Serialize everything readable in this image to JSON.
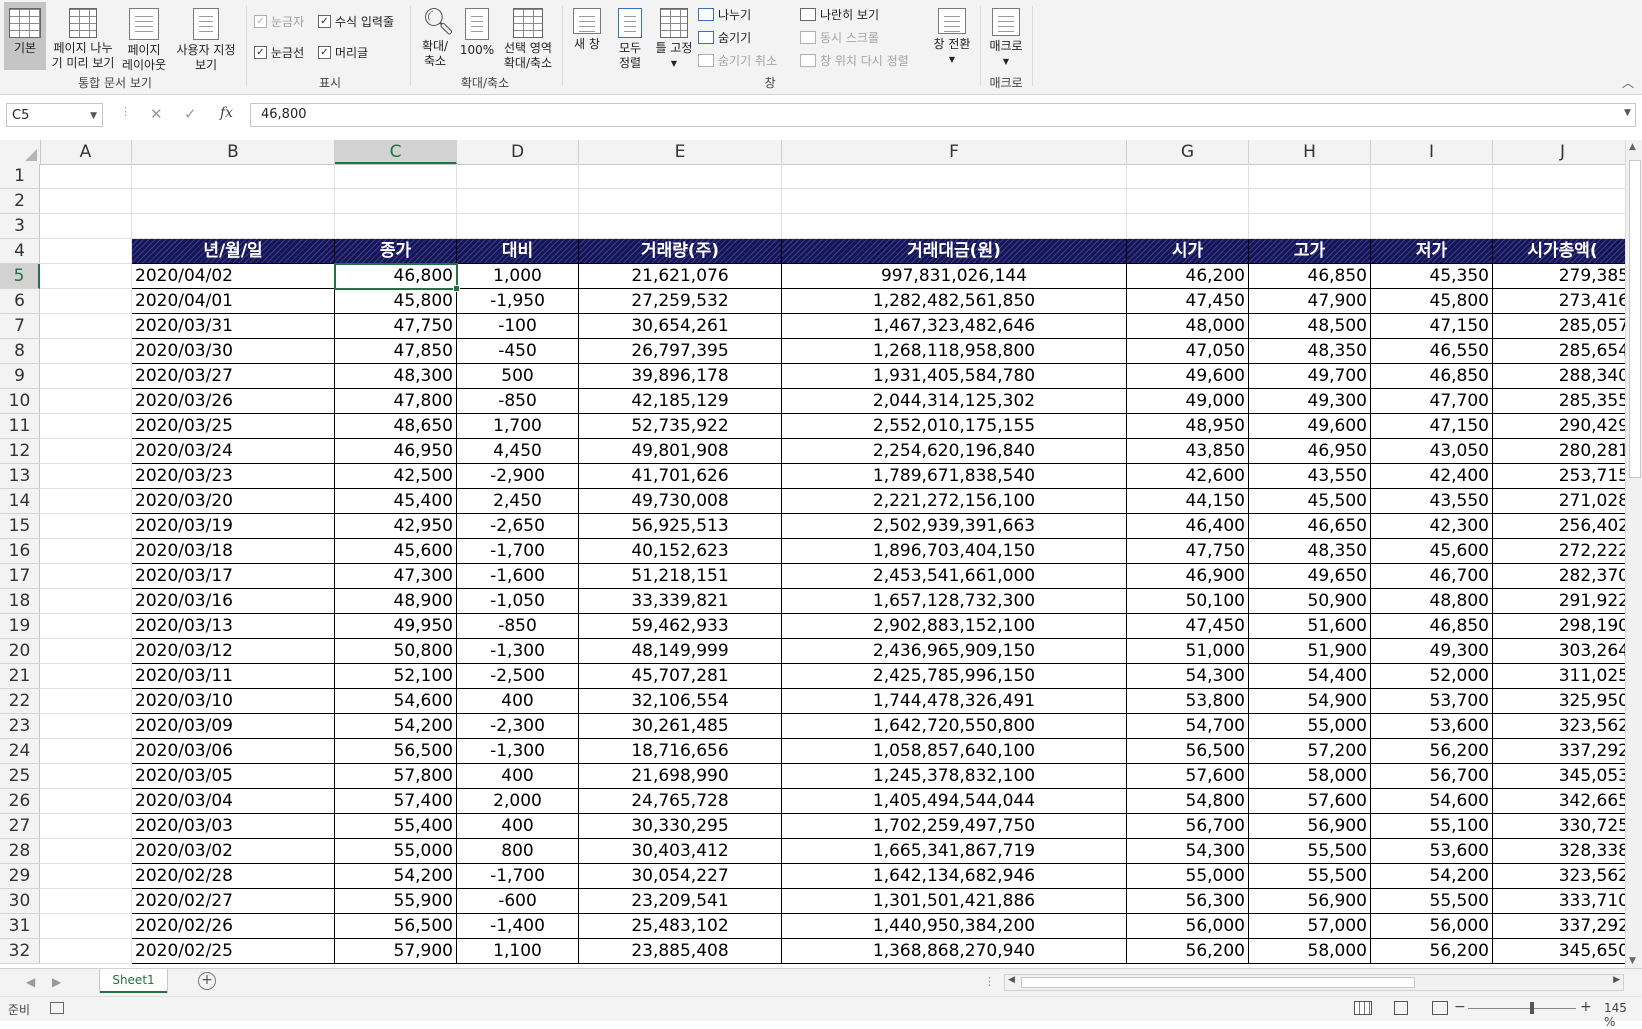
{
  "ribbon": {
    "views_group": {
      "label": "통합 문서 보기",
      "normal": "기본",
      "page_break_line1": "페이지 나누",
      "page_break_line2": "기 미리 보기",
      "page_layout_line1": "페이지",
      "page_layout_line2": "레이아웃",
      "custom_line1": "사용자 지정",
      "custom_line2": "보기"
    },
    "show_group": {
      "label": "표시",
      "ruler": "눈금자",
      "gridlines": "눈금선",
      "formula_bar": "수식 입력줄",
      "headings": "머리글"
    },
    "zoom_group": {
      "label": "확대/축소",
      "zoom_line1": "확대/",
      "zoom_line2": "축소",
      "zoom100": "100%",
      "zoom_sel_line1": "선택 영역",
      "zoom_sel_line2": "확대/축소"
    },
    "window_group": {
      "label": "창",
      "new_window": "새 창",
      "arrange_line1": "모두",
      "arrange_line2": "정렬",
      "freeze": "틀 고정",
      "split": "나누기",
      "hide": "숨기기",
      "unhide": "숨기기 취소",
      "side_by_side": "나란히 보기",
      "sync_scroll": "동시 스크롤",
      "reset_pos": "창 위치 다시 정렬",
      "switch_line1": "창 전환"
    },
    "macro_group": {
      "label": "매크로",
      "macro": "매크로"
    }
  },
  "formula_bar": {
    "name_box": "C5",
    "value": "46,800"
  },
  "columns": [
    "A",
    "B",
    "C",
    "D",
    "E",
    "F",
    "G",
    "H",
    "I",
    "J"
  ],
  "row_numbers": [
    1,
    2,
    3,
    4,
    5,
    6,
    7,
    8,
    9,
    10,
    11,
    12,
    13,
    14,
    15,
    16,
    17,
    18,
    19,
    20,
    21,
    22,
    23,
    24,
    25,
    26,
    27,
    28,
    29,
    30,
    31,
    32
  ],
  "table": {
    "headers": [
      "년/월/일",
      "종가",
      "대비",
      "거래량(주)",
      "거래대금(원)",
      "시가",
      "고가",
      "저가",
      "시가총액("
    ],
    "rows": [
      [
        "2020/04/02",
        "46,800",
        "1,000",
        "21,621,076",
        "997,831,026,144",
        "46,200",
        "46,850",
        "45,350",
        "279,385"
      ],
      [
        "2020/04/01",
        "45,800",
        "-1,950",
        "27,259,532",
        "1,282,482,561,850",
        "47,450",
        "47,900",
        "45,800",
        "273,416"
      ],
      [
        "2020/03/31",
        "47,750",
        "-100",
        "30,654,261",
        "1,467,323,482,646",
        "48,000",
        "48,500",
        "47,150",
        "285,057"
      ],
      [
        "2020/03/30",
        "47,850",
        "-450",
        "26,797,395",
        "1,268,118,958,800",
        "47,050",
        "48,350",
        "46,550",
        "285,654"
      ],
      [
        "2020/03/27",
        "48,300",
        "500",
        "39,896,178",
        "1,931,405,584,780",
        "49,600",
        "49,700",
        "46,850",
        "288,340"
      ],
      [
        "2020/03/26",
        "47,800",
        "-850",
        "42,185,129",
        "2,044,314,125,302",
        "49,000",
        "49,300",
        "47,700",
        "285,355"
      ],
      [
        "2020/03/25",
        "48,650",
        "1,700",
        "52,735,922",
        "2,552,010,175,155",
        "48,950",
        "49,600",
        "47,150",
        "290,429"
      ],
      [
        "2020/03/24",
        "46,950",
        "4,450",
        "49,801,908",
        "2,254,620,196,840",
        "43,850",
        "46,950",
        "43,050",
        "280,281"
      ],
      [
        "2020/03/23",
        "42,500",
        "-2,900",
        "41,701,626",
        "1,789,671,838,540",
        "42,600",
        "43,550",
        "42,400",
        "253,715"
      ],
      [
        "2020/03/20",
        "45,400",
        "2,450",
        "49,730,008",
        "2,221,272,156,100",
        "44,150",
        "45,500",
        "43,550",
        "271,028"
      ],
      [
        "2020/03/19",
        "42,950",
        "-2,650",
        "56,925,513",
        "2,502,939,391,663",
        "46,400",
        "46,650",
        "42,300",
        "256,402"
      ],
      [
        "2020/03/18",
        "45,600",
        "-1,700",
        "40,152,623",
        "1,896,703,404,150",
        "47,750",
        "48,350",
        "45,600",
        "272,222"
      ],
      [
        "2020/03/17",
        "47,300",
        "-1,600",
        "51,218,151",
        "2,453,541,661,000",
        "46,900",
        "49,650",
        "46,700",
        "282,370"
      ],
      [
        "2020/03/16",
        "48,900",
        "-1,050",
        "33,339,821",
        "1,657,128,732,300",
        "50,100",
        "50,900",
        "48,800",
        "291,922"
      ],
      [
        "2020/03/13",
        "49,950",
        "-850",
        "59,462,933",
        "2,902,883,152,100",
        "47,450",
        "51,600",
        "46,850",
        "298,190"
      ],
      [
        "2020/03/12",
        "50,800",
        "-1,300",
        "48,149,999",
        "2,436,965,909,150",
        "51,000",
        "51,900",
        "49,300",
        "303,264"
      ],
      [
        "2020/03/11",
        "52,100",
        "-2,500",
        "45,707,281",
        "2,425,785,996,150",
        "54,300",
        "54,400",
        "52,000",
        "311,025"
      ],
      [
        "2020/03/10",
        "54,600",
        "400",
        "32,106,554",
        "1,744,478,326,491",
        "53,800",
        "54,900",
        "53,700",
        "325,950"
      ],
      [
        "2020/03/09",
        "54,200",
        "-2,300",
        "30,261,485",
        "1,642,720,550,800",
        "54,700",
        "55,000",
        "53,600",
        "323,562"
      ],
      [
        "2020/03/06",
        "56,500",
        "-1,300",
        "18,716,656",
        "1,058,857,640,100",
        "56,500",
        "57,200",
        "56,200",
        "337,292"
      ],
      [
        "2020/03/05",
        "57,800",
        "400",
        "21,698,990",
        "1,245,378,832,100",
        "57,600",
        "58,000",
        "56,700",
        "345,053"
      ],
      [
        "2020/03/04",
        "57,400",
        "2,000",
        "24,765,728",
        "1,405,494,544,044",
        "54,800",
        "57,600",
        "54,600",
        "342,665"
      ],
      [
        "2020/03/03",
        "55,400",
        "400",
        "30,330,295",
        "1,702,259,497,750",
        "56,700",
        "56,900",
        "55,100",
        "330,725"
      ],
      [
        "2020/03/02",
        "55,000",
        "800",
        "30,403,412",
        "1,665,341,867,719",
        "54,300",
        "55,500",
        "53,600",
        "328,338"
      ],
      [
        "2020/02/28",
        "54,200",
        "-1,700",
        "30,054,227",
        "1,642,134,682,946",
        "55,000",
        "55,500",
        "54,200",
        "323,562"
      ],
      [
        "2020/02/27",
        "55,900",
        "-600",
        "23,209,541",
        "1,301,501,421,886",
        "56,300",
        "56,900",
        "55,500",
        "333,710"
      ],
      [
        "2020/02/26",
        "56,500",
        "-1,400",
        "25,483,102",
        "1,440,950,384,200",
        "56,000",
        "57,000",
        "56,000",
        "337,292"
      ],
      [
        "2020/02/25",
        "57,900",
        "1,100",
        "23,885,408",
        "1,368,868,270,940",
        "56,200",
        "58,000",
        "56,200",
        "345,650"
      ]
    ]
  },
  "sheet_tabs": [
    "Sheet1"
  ],
  "status": {
    "ready": "준비",
    "zoom": "145 %"
  }
}
